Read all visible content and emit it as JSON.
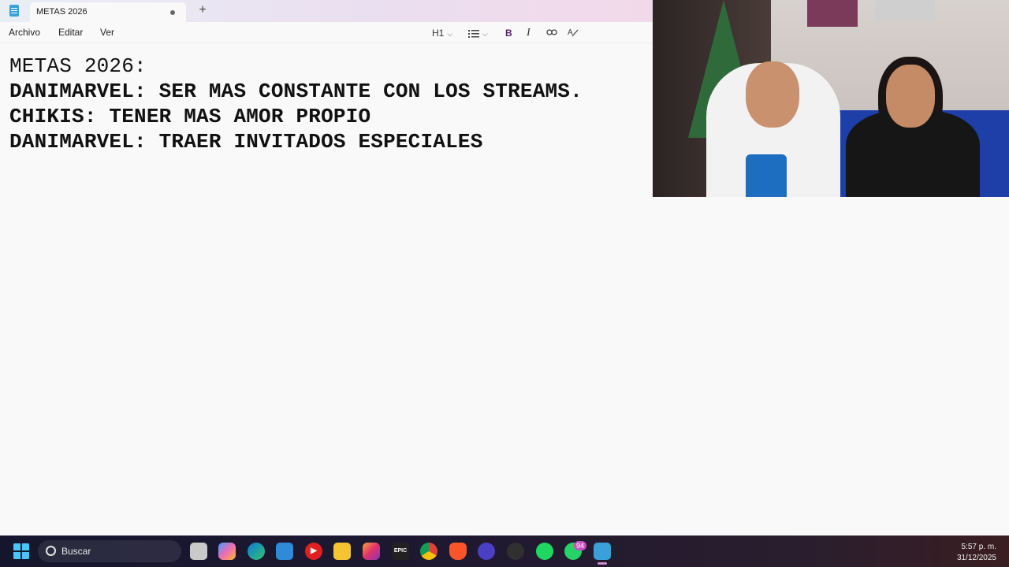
{
  "window": {
    "tab_title": "METAS 2026",
    "new_tab_label": "+"
  },
  "menu": {
    "archivo": "Archivo",
    "editar": "Editar",
    "ver": "Ver"
  },
  "format_toolbar": {
    "heading": "H1",
    "bold": "B",
    "italic": "I"
  },
  "document": {
    "lines": [
      "METAS 2026:",
      "DANIMARVEL: SER MAS CONSTANTE CON LOS STREAMS.",
      "CHIKIS: TENER MAS AMOR PROPIO",
      "DANIMARVEL: TRAER INVITADOS ESPECIALES"
    ]
  },
  "taskbar": {
    "search_placeholder": "Buscar",
    "epic_label": "EPIC",
    "whatsapp_badge": "94",
    "time": "5:57 p. m.",
    "date": "31/12/2025",
    "apps": [
      "windows-start-icon",
      "task-view-icon",
      "copilot-icon",
      "edge-icon",
      "store-icon",
      "youtube-music-icon",
      "file-explorer-icon",
      "instagram-icon",
      "epic-games-icon",
      "chrome-icon",
      "brave-icon",
      "cortana-icon",
      "obs-icon",
      "spotify-icon",
      "whatsapp-icon",
      "notepad-icon"
    ]
  },
  "colors": {
    "accent": "#5a1a6e",
    "notepad_blue": "#3aa0d9",
    "taskbar_bg": "#15162e"
  }
}
